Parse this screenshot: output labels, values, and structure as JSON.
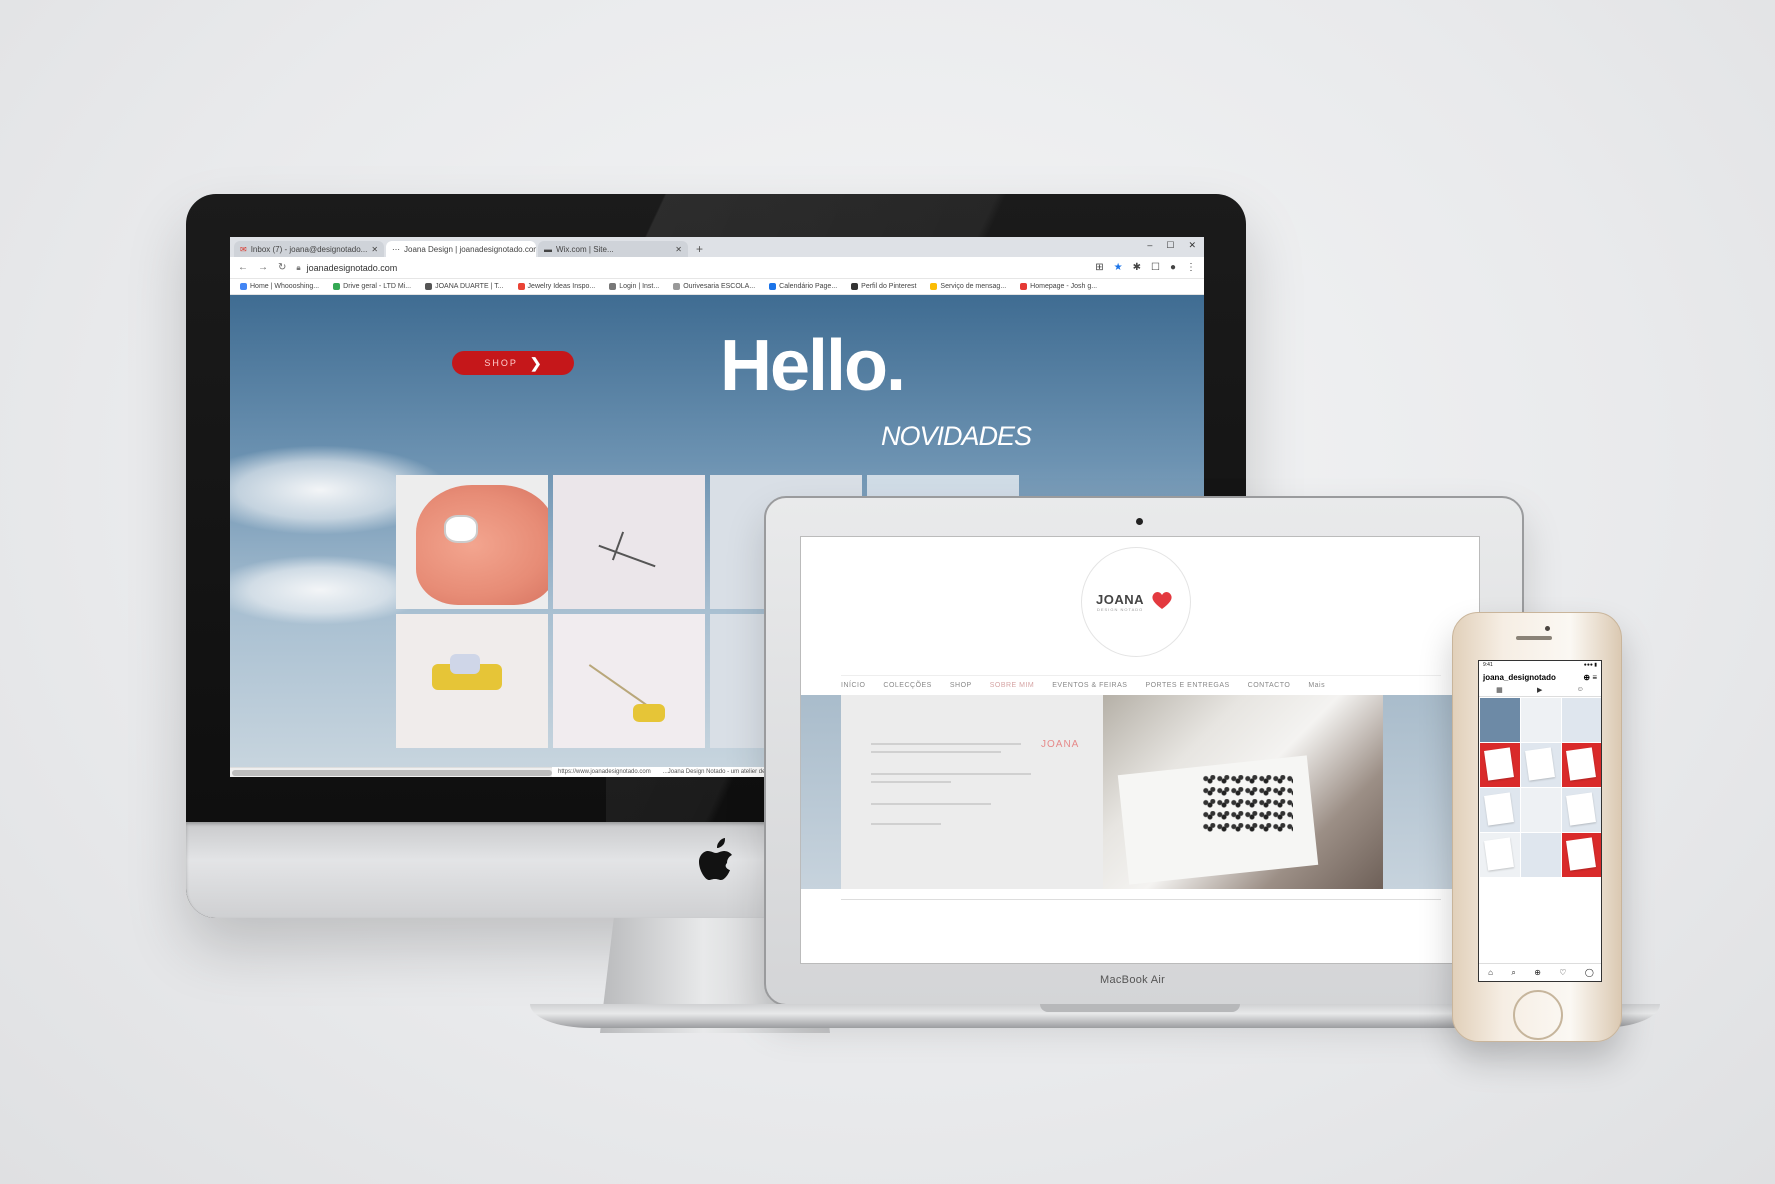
{
  "imac": {
    "browser": {
      "tabs": [
        {
          "label": "Inbox (7) - joana@designotado..."
        },
        {
          "label": "Joana Design | joanadesignotado.com",
          "active": true
        },
        {
          "label": "Wix.com | Site..."
        }
      ],
      "new_tab": "+",
      "window_controls": [
        "–",
        "☐",
        "✕"
      ],
      "url": "joanadesignotado.com",
      "bookmarks": [
        {
          "label": "Home | Whoooshing...",
          "color": "#4285f4"
        },
        {
          "label": "Drive geral - LTD Mi...",
          "color": "#34a853"
        },
        {
          "label": "JOANA DUARTE | T...",
          "color": "#555555"
        },
        {
          "label": "Jewelry Ideas Inspo...",
          "color": "#ea4335"
        },
        {
          "label": "Login | Inst...",
          "color": "#777777"
        },
        {
          "label": "Ourivesaria ESCOLA...",
          "color": "#999999"
        },
        {
          "label": "Calendário Page...",
          "color": "#1a73e8"
        },
        {
          "label": "Perfil do Pinterest",
          "color": "#333333"
        },
        {
          "label": "Serviço de mensag...",
          "color": "#fbbc04"
        },
        {
          "label": "Homepage - Josh g...",
          "color": "#e53935"
        }
      ]
    },
    "site": {
      "shop_label": "SHOP",
      "hero_title": "Hello.",
      "section_title": "NOVIDADES",
      "status_text": [
        "https://www.joanadesignotado.com",
        "...Joana Design Notado - um atelier de joalharia contemporânea..."
      ]
    }
  },
  "macbook": {
    "label": "MacBook Air",
    "site": {
      "logo_text": "JOANA",
      "logo_sub": "DESIGN NOTADO",
      "nav": [
        {
          "label": "INÍCIO"
        },
        {
          "label": "COLECÇÕES"
        },
        {
          "label": "SHOP"
        },
        {
          "label": "SOBRE MIM",
          "active": true
        },
        {
          "label": "EVENTOS & FEIRAS"
        },
        {
          "label": "PORTES E ENTREGAS"
        },
        {
          "label": "CONTACTO"
        },
        {
          "label": "Mais"
        }
      ],
      "about_highlight": "JOANA"
    }
  },
  "iphone": {
    "status_time": "9:41",
    "status_icons": "●●● ▮",
    "username": "joana_designotado",
    "header_icons": "⊕ ≡",
    "tabs": [
      "▦",
      "▶",
      "☺"
    ],
    "bottom_icons": [
      "⌂",
      "⌕",
      "⊕",
      "♡",
      "◯"
    ]
  },
  "colors": {
    "shop_red": "#c5171a",
    "logo_red": "#e3393f",
    "nav_active": "#d5a3a3"
  }
}
